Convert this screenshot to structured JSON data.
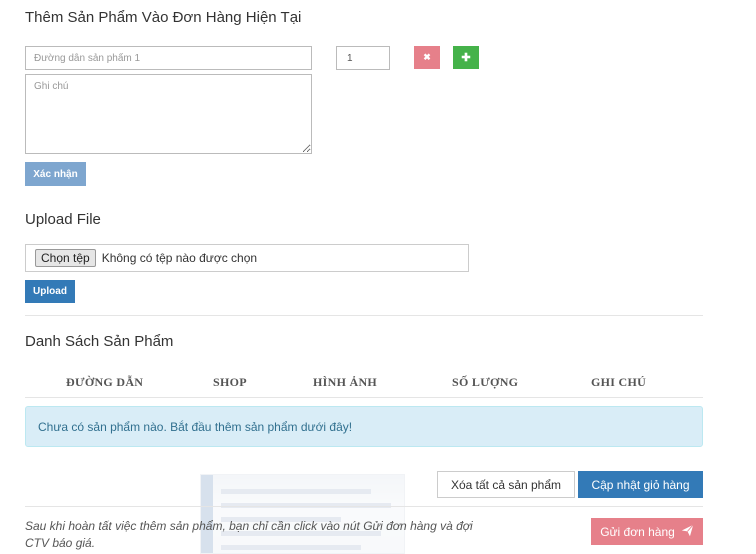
{
  "add_section": {
    "title": "Thêm Sản Phẩm Vào Đơn Hàng Hiện Tại",
    "url_placeholder": "Đường dẫn sản phẩm 1",
    "quantity_value": "1",
    "note_placeholder": "Ghi chú",
    "remove_icon": "✖",
    "add_icon": "✚",
    "confirm_label": "Xác nhận"
  },
  "upload_section": {
    "title": "Upload File",
    "choose_file_label": "Chọn tệp",
    "no_file_text": "Không có tệp nào được chọn",
    "upload_label": "Upload"
  },
  "product_list": {
    "title": "Danh Sách Sản Phẩm",
    "columns": [
      "ĐƯỜNG DẪN",
      "SHOP",
      "HÌNH ẢNH",
      "SỐ LƯỢNG",
      "GHI CHÚ"
    ],
    "empty_message": "Chưa có sản phẩm nào. Bắt đầu thêm sản phẩm dưới đây!"
  },
  "cart_actions": {
    "clear_all_label": "Xóa tất cả sản phẩm",
    "update_cart_label": "Cập nhật giỏ hàng"
  },
  "footer": {
    "instruction_line1": "Sau khi hoàn tất việc thêm sản phẩm, bạn chỉ cần click vào nút Gửi đơn hàng và đợi",
    "instruction_line2": "CTV báo giá.",
    "send_order_label": "Gửi đơn hàng",
    "send_icon": "paper-plane-icon"
  },
  "colors": {
    "primary": "#337ab7",
    "danger": "#e6808a",
    "success": "#45b24a",
    "info_bg": "#d9edf7",
    "info_text": "#31708f"
  }
}
